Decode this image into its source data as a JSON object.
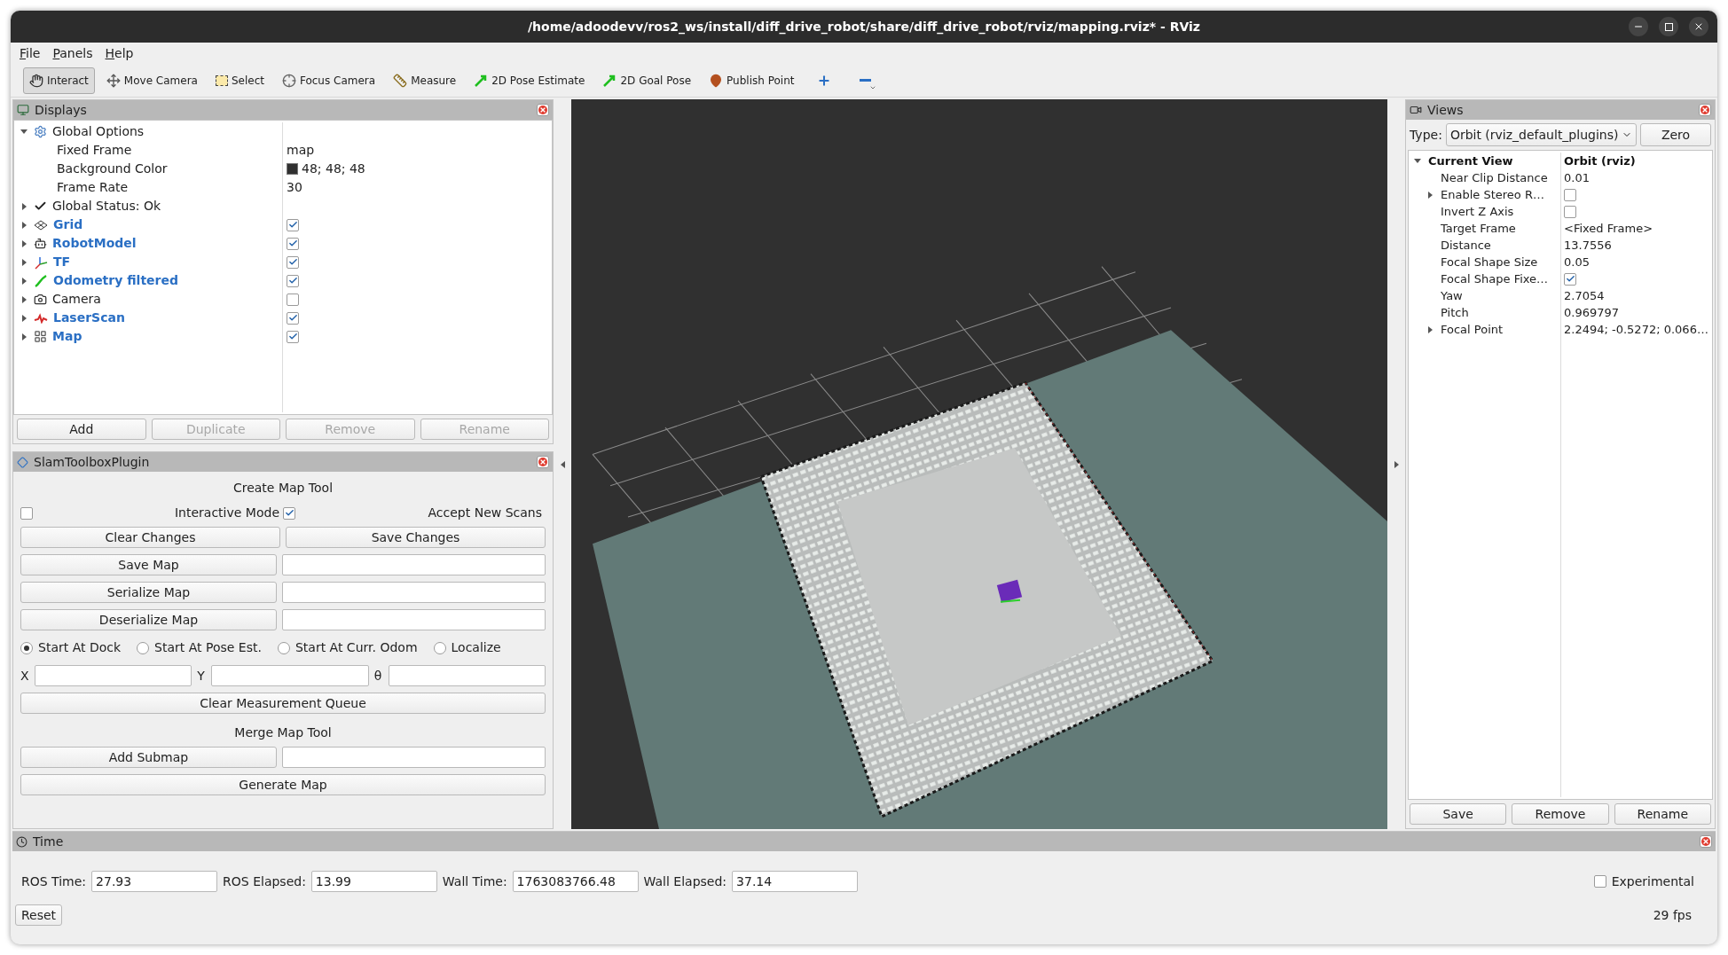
{
  "window": {
    "title": "/home/adoodevv/ros2_ws/install/diff_drive_robot/share/diff_drive_robot/rviz/mapping.rviz* - RViz"
  },
  "menu": [
    "File",
    "Panels",
    "Help"
  ],
  "toolbar": [
    {
      "label": "Interact",
      "kind": "interact",
      "selected": true
    },
    {
      "label": "Move Camera",
      "kind": "move",
      "selected": false
    },
    {
      "label": "Select",
      "kind": "select",
      "selected": false
    },
    {
      "label": "Focus Camera",
      "kind": "focus",
      "selected": false
    },
    {
      "label": "Measure",
      "kind": "measure",
      "selected": false
    },
    {
      "label": "2D Pose Estimate",
      "kind": "pose",
      "selected": false
    },
    {
      "label": "2D Goal Pose",
      "kind": "pose",
      "selected": false
    },
    {
      "label": "Publish Point",
      "kind": "point",
      "selected": false
    },
    {
      "kind": "add",
      "selected": false
    },
    {
      "kind": "remove",
      "selected": false
    }
  ],
  "displays": {
    "title": "Displays",
    "tree": [
      {
        "label": "Global Options",
        "kind": "gear",
        "expanded": true,
        "children": [
          {
            "label": "Fixed Frame",
            "value": "map"
          },
          {
            "label": "Background Color",
            "value": "48; 48; 48",
            "color": "#303030"
          },
          {
            "label": "Frame Rate",
            "value": "30"
          }
        ]
      },
      {
        "label": "Global Status: Ok",
        "kind": "status",
        "expanded": false
      },
      {
        "label": "Grid",
        "kind": "grid",
        "expanded": false,
        "checked": true
      },
      {
        "label": "RobotModel",
        "kind": "robot",
        "expanded": false,
        "checked": true
      },
      {
        "label": "TF",
        "kind": "tf",
        "expanded": false,
        "checked": true
      },
      {
        "label": "Odometry filtered",
        "kind": "odometry",
        "expanded": false,
        "checked": true
      },
      {
        "label": "Camera",
        "kind": "camera",
        "expanded": false,
        "checked": false
      },
      {
        "label": "LaserScan",
        "kind": "laser",
        "expanded": false,
        "checked": true
      },
      {
        "label": "Map",
        "kind": "map",
        "expanded": false,
        "checked": true
      }
    ],
    "buttons": [
      {
        "label": "Add",
        "disabled": false
      },
      {
        "label": "Duplicate",
        "disabled": true
      },
      {
        "label": "Remove",
        "disabled": true
      },
      {
        "label": "Rename",
        "disabled": true
      }
    ]
  },
  "slam": {
    "title": "SlamToolboxPlugin",
    "create_heading": "Create Map Tool",
    "options": [
      {
        "label": "Interactive Mode",
        "checked": false
      },
      {
        "label": "Accept New Scans",
        "checked": true
      }
    ],
    "change_buttons": [
      "Clear Changes",
      "Save Changes"
    ],
    "file_actions": [
      {
        "button": "Save Map"
      },
      {
        "button": "Serialize Map"
      },
      {
        "button": "Deserialize Map"
      }
    ],
    "start_modes": [
      {
        "label": "Start At Dock",
        "selected": true
      },
      {
        "label": "Start At Pose Est.",
        "selected": false
      },
      {
        "label": "Start At Curr. Odom",
        "selected": false
      },
      {
        "label": "Localize",
        "selected": false
      }
    ],
    "pose_fields": [
      "X",
      "Y",
      "θ"
    ],
    "clear_queue": "Clear Measurement Queue",
    "merge_heading": "Merge Map Tool",
    "submap_button": "Add Submap",
    "generate_button": "Generate Map"
  },
  "views": {
    "title": "Views",
    "type_label": "Type:",
    "type_value": "Orbit (rviz_default_plugins)",
    "zero": "Zero",
    "header": {
      "label": "Current View",
      "value": "Orbit (rviz)",
      "expanded": true
    },
    "rows": [
      {
        "label": "Near Clip Distance",
        "kind": "text",
        "value": "0.01",
        "expandable": false
      },
      {
        "label": "Enable Stereo R…",
        "kind": "checkbox",
        "checked": false,
        "expandable": true
      },
      {
        "label": "Invert Z Axis",
        "kind": "checkbox",
        "checked": false,
        "expandable": false
      },
      {
        "label": "Target Frame",
        "kind": "text",
        "value": "<Fixed Frame>",
        "expandable": false
      },
      {
        "label": "Distance",
        "kind": "text",
        "value": "13.7556",
        "expandable": false
      },
      {
        "label": "Focal Shape Size",
        "kind": "text",
        "value": "0.05",
        "expandable": false
      },
      {
        "label": "Focal Shape Fixe…",
        "kind": "checkbox",
        "checked": true,
        "expandable": false
      },
      {
        "label": "Yaw",
        "kind": "text",
        "value": "2.7054",
        "expandable": false
      },
      {
        "label": "Pitch",
        "kind": "text",
        "value": "0.969797",
        "expandable": false
      },
      {
        "label": "Focal Point",
        "kind": "text",
        "value": "2.2494; -0.5272; 0.066…",
        "expandable": true
      }
    ],
    "buttons": [
      "Save",
      "Remove",
      "Rename"
    ]
  },
  "time": {
    "title": "Time",
    "fields": [
      {
        "label": "ROS Time:",
        "value": "27.93"
      },
      {
        "label": "ROS Elapsed:",
        "value": "13.99"
      },
      {
        "label": "Wall Time:",
        "value": "1763083766.48"
      },
      {
        "label": "Wall Elapsed:",
        "value": "37.14"
      }
    ],
    "experimental": {
      "label": "Experimental",
      "checked": false
    },
    "reset": "Reset",
    "fps": "29 fps"
  }
}
